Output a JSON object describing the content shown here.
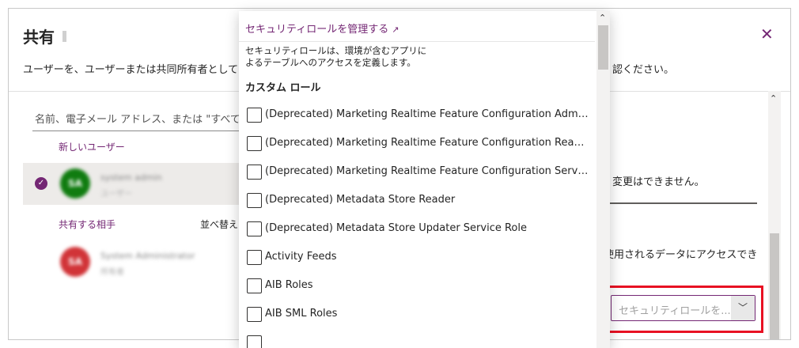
{
  "dialog": {
    "title": "共有",
    "desc_left": "ユーザーを、ユーザーまたは共同所有者として",
    "desc_right": "認ください。",
    "search_placeholder": "名前、電子メール アドレス、または \"すべての",
    "new_user_link": "新しいユーザー",
    "selected_user": {
      "initials": "SA",
      "name": "system admin",
      "subtitle": "ユーザー"
    },
    "shared_with_label": "共有する相手",
    "sort_label": "並べ替え",
    "shared_user": {
      "initials": "SA",
      "name": "System Administrator",
      "subtitle": "所有者"
    },
    "right_msg1": "変更はできません。",
    "right_msg2": "使用されるデータにアクセスでき",
    "role_placeholder": "セキュリティロールを..."
  },
  "panel": {
    "manage_link": "セキュリティロールを管理する",
    "description": "セキュリティロールは、環境が含むアプリによるテーブルへのアクセスを定義します。",
    "section_title": "カスタム ロール",
    "roles": [
      "(Deprecated) Marketing Realtime Feature Configuration Administ...",
      "(Deprecated) Marketing Realtime Feature Configuration Reader",
      "(Deprecated) Marketing Realtime Feature Configuration Services ...",
      "(Deprecated) Metadata Store Reader",
      "(Deprecated) Metadata Store Updater Service Role",
      "Activity Feeds",
      "AIB Roles",
      "AIB SML Roles"
    ]
  },
  "colors": {
    "accent": "#742774",
    "highlight": "#e81123"
  }
}
